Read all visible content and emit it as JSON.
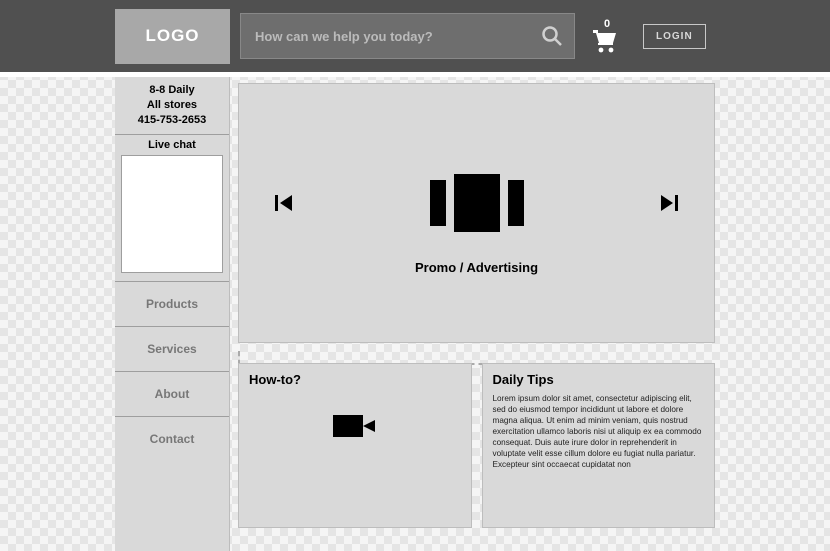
{
  "header": {
    "logo": "LOGO",
    "search_placeholder": "How can we help you today?",
    "cart_count": "0",
    "login_label": "LOGIN"
  },
  "sidebar": {
    "hours": "8-8 Daily",
    "stores": "All stores",
    "phone": "415-753-2653",
    "chat_label": "Live chat",
    "nav": {
      "products": "Products",
      "services": "Services",
      "about": "About",
      "contact": "Contact"
    }
  },
  "hero": {
    "caption": "Promo / Advertising"
  },
  "panels": {
    "howto_title": "How-to?",
    "tips_title": "Daily Tips",
    "tips_body": "Lorem ipsum dolor sit amet, consectetur adipiscing elit, sed do eiusmod tempor incididunt ut labore et dolore magna aliqua. Ut enim ad minim veniam, quis nostrud exercitation ullamco laboris nisi ut aliquip ex ea commodo consequat. Duis aute irure dolor in reprehenderit in voluptate velit esse cillum dolore eu fugiat nulla pariatur. Excepteur sint occaecat cupidatat non"
  }
}
